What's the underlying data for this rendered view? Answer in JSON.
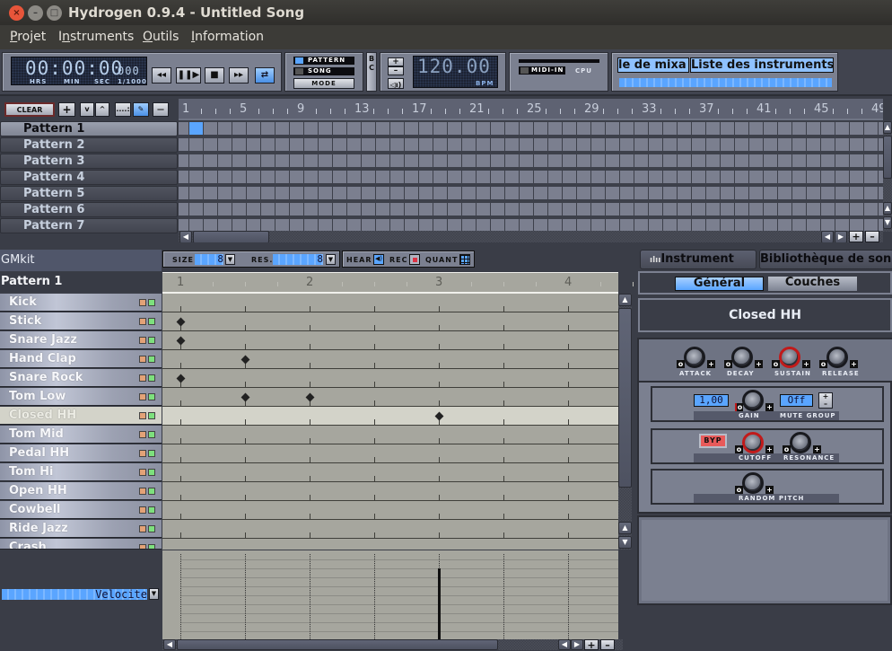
{
  "window": {
    "title": "Hydrogen 0.9.4 - Untitled Song",
    "buttons": {
      "close": "×",
      "minimize": "–",
      "maximize": "□"
    }
  },
  "menu": [
    {
      "label": "Projet",
      "mnemonic": "P"
    },
    {
      "label": "Instruments",
      "mnemonic": "n"
    },
    {
      "label": "Outils",
      "mnemonic": "O"
    },
    {
      "label": "Information",
      "mnemonic": "I"
    }
  ],
  "transport": {
    "time_display": "00:00:00",
    "millis_display": "000",
    "time_labels": [
      "HRS",
      "MIN",
      "SEC",
      "1/1000"
    ],
    "buttons": {
      "rewind": "◂◂",
      "play_pause": "❚❚▶",
      "stop": "■",
      "forward": "▸▸",
      "loop": "⇄"
    },
    "mode": {
      "pattern_label": "PATTERN",
      "song_label": "SONG",
      "mode_button": "MODE",
      "active": "PATTERN"
    },
    "bc_labels": [
      "B",
      "C"
    ],
    "bpm_value": "120.00",
    "bpm_label": "BPM",
    "bpm_plus": "+",
    "bpm_minus": "–",
    "metronome_icon": "speaker-icon",
    "midi_in_label": "MIDI-IN",
    "cpu_label": "CPU",
    "mixer_tab": "le de mixa",
    "instrument_list_tab": "Liste des instruments"
  },
  "song_editor": {
    "toolbar": {
      "clear": "CLEAR",
      "add": "+",
      "move_down": "v",
      "move_up": "^",
      "select_mode": "....:",
      "draw_mode": "✎",
      "delete": "—"
    },
    "patterns": [
      "Pattern 1",
      "Pattern 2",
      "Pattern 3",
      "Pattern 4",
      "Pattern 5",
      "Pattern 6",
      "Pattern 7"
    ],
    "selected_pattern": 0,
    "ruler_numbers": [
      "1",
      "5",
      "9",
      "13",
      "17",
      "21",
      "25",
      "29",
      "33",
      "37",
      "41",
      "45",
      "49"
    ],
    "active_cells": [
      {
        "pattern": 0,
        "bar": 1
      }
    ],
    "zoom_in": "+",
    "zoom_out": "–"
  },
  "pattern_editor": {
    "drumkit": "GMkit",
    "pattern_name": "Pattern 1",
    "size_label": "SIZE",
    "size_value": "8",
    "res_label": "RES.",
    "res_value": "8",
    "hear_label": "HEAR",
    "rec_label": "REC",
    "quant_label": "QUANT",
    "ruler_numbers": [
      "1",
      "2",
      "3",
      "4"
    ],
    "instruments": [
      "Kick",
      "Stick",
      "Snare Jazz",
      "Hand Clap",
      "Snare Rock",
      "Tom Low",
      "Closed HH",
      "Tom Mid",
      "Pedal HH",
      "Tom Hi",
      "Open HH",
      "Cowbell",
      "Ride Jazz",
      "Crash"
    ],
    "selected_instrument": 6,
    "notes": [
      {
        "row": 1,
        "step": 0
      },
      {
        "row": 2,
        "step": 0
      },
      {
        "row": 3,
        "step": 2
      },
      {
        "row": 4,
        "step": 0
      },
      {
        "row": 5,
        "step": 2
      },
      {
        "row": 5,
        "step": 4
      },
      {
        "row": 6,
        "step": 8
      }
    ],
    "velocity_label": "Velocite",
    "velocity_bars": [
      {
        "step": 8,
        "value": 0.8
      }
    ],
    "zoom_in": "+",
    "zoom_out": "–"
  },
  "instrument_panel": {
    "tabs": {
      "instrument": "Instrument",
      "library": "Bibliothèque de son"
    },
    "subtabs": {
      "general": "Général",
      "layers": "Couches"
    },
    "instrument_name": "Closed HH",
    "envelope": [
      "ATTACK",
      "DECAY",
      "SUSTAIN",
      "RELEASE"
    ],
    "gain_value": "1,00",
    "gain_label": "GAIN",
    "mute_group_value": "Off",
    "mute_group_label": "MUTE GROUP",
    "bypass_label": "BYP",
    "cutoff_label": "CUTOFF",
    "resonance_label": "RESONANCE",
    "random_pitch_label": "RANDOM PITCH",
    "knob_min": "o",
    "knob_max": "+"
  },
  "colors": {
    "accent_blue": "#5aa5ff",
    "active_red": "#c11a1a",
    "note": "#222222"
  }
}
